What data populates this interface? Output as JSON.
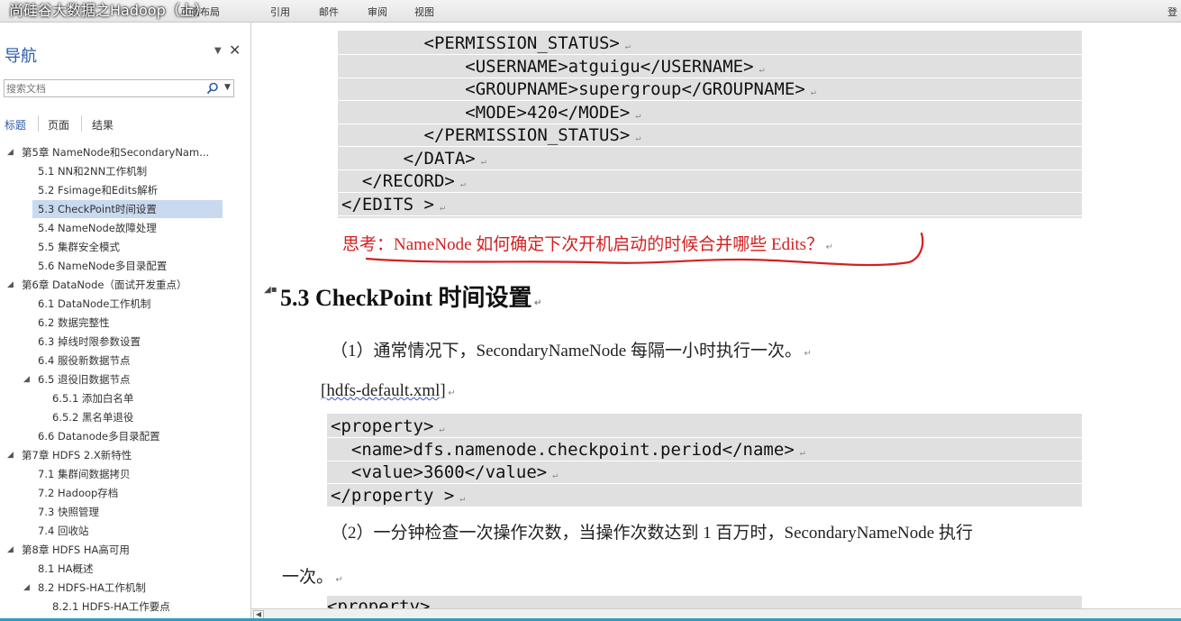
{
  "video": {
    "title": "尚硅谷大数据之Hadoop（上）",
    "progress_fraction": 1.0
  },
  "menu": [
    "页面布局",
    "引用",
    "邮件",
    "审阅",
    "视图"
  ],
  "menu_right": "登",
  "nav": {
    "title": "导航",
    "search_placeholder": "搜索文档",
    "tabs": [
      "标题",
      "页面",
      "结果"
    ],
    "items": [
      {
        "label": "第5章 NameNode和SecondaryNam...",
        "expandable": true
      },
      {
        "label": "5.1 NN和2NN工作机制"
      },
      {
        "label": "5.2 Fsimage和Edits解析"
      },
      {
        "label": "5.3 CheckPoint时间设置",
        "selected": true
      },
      {
        "label": "5.4 NameNode故障处理"
      },
      {
        "label": "5.5 集群安全模式"
      },
      {
        "label": "5.6 NameNode多目录配置"
      },
      {
        "label": "第6章 DataNode（面试开发重点）",
        "expandable": true
      },
      {
        "label": "6.1 DataNode工作机制"
      },
      {
        "label": "6.2 数据完整性"
      },
      {
        "label": "6.3 掉线时限参数设置"
      },
      {
        "label": "6.4 服役新数据节点"
      },
      {
        "label": "6.5 退役旧数据节点",
        "expandable": true
      },
      {
        "label": "6.5.1 添加白名单"
      },
      {
        "label": "6.5.2 黑名单退役"
      },
      {
        "label": "6.6 Datanode多目录配置"
      },
      {
        "label": "第7章 HDFS 2.X新特性",
        "expandable": true
      },
      {
        "label": "7.1 集群间数据拷贝"
      },
      {
        "label": "7.2 Hadoop存档"
      },
      {
        "label": "7.3 快照管理"
      },
      {
        "label": "7.4 回收站"
      },
      {
        "label": "第8章 HDFS HA高可用",
        "expandable": true
      },
      {
        "label": "8.1 HA概述"
      },
      {
        "label": "8.2 HDFS-HA工作机制",
        "expandable": true
      },
      {
        "label": "8.2.1 HDFS-HA工作要点"
      }
    ]
  },
  "doc": {
    "code1": [
      "        <PERMISSION_STATUS>",
      "            <USERNAME>atguigu</USERNAME>",
      "            <GROUPNAME>supergroup</GROUPNAME>",
      "            <MODE>420</MODE>",
      "        </PERMISSION_STATUS>",
      "      </DATA>",
      "  </RECORD>",
      "</EDITS >"
    ],
    "note": "思考：NameNode 如何确定下次开机启动的时候合并哪些 Edits？",
    "heading": "5.3 CheckPoint 时间设置",
    "para1": "（1）通常情况下，SecondaryNameNode 每隔一小时执行一次。",
    "file_label": "[hdfs-default.xml]",
    "code2": [
      "<property>",
      "  <name>dfs.namenode.checkpoint.period</name>",
      "  <value>3600</value>",
      "</property >"
    ],
    "para2": "（2）一分钟检查一次操作次数，当操作次数达到 1 百万时，SecondaryNameNode 执行",
    "para2_cont": "一次。",
    "code3_partial": "<property>"
  },
  "colors": {
    "accent": "#2a5da8",
    "note_red": "#d42020",
    "code_bg": "#e0e0e0",
    "selected_bg": "#c9d9ef"
  }
}
